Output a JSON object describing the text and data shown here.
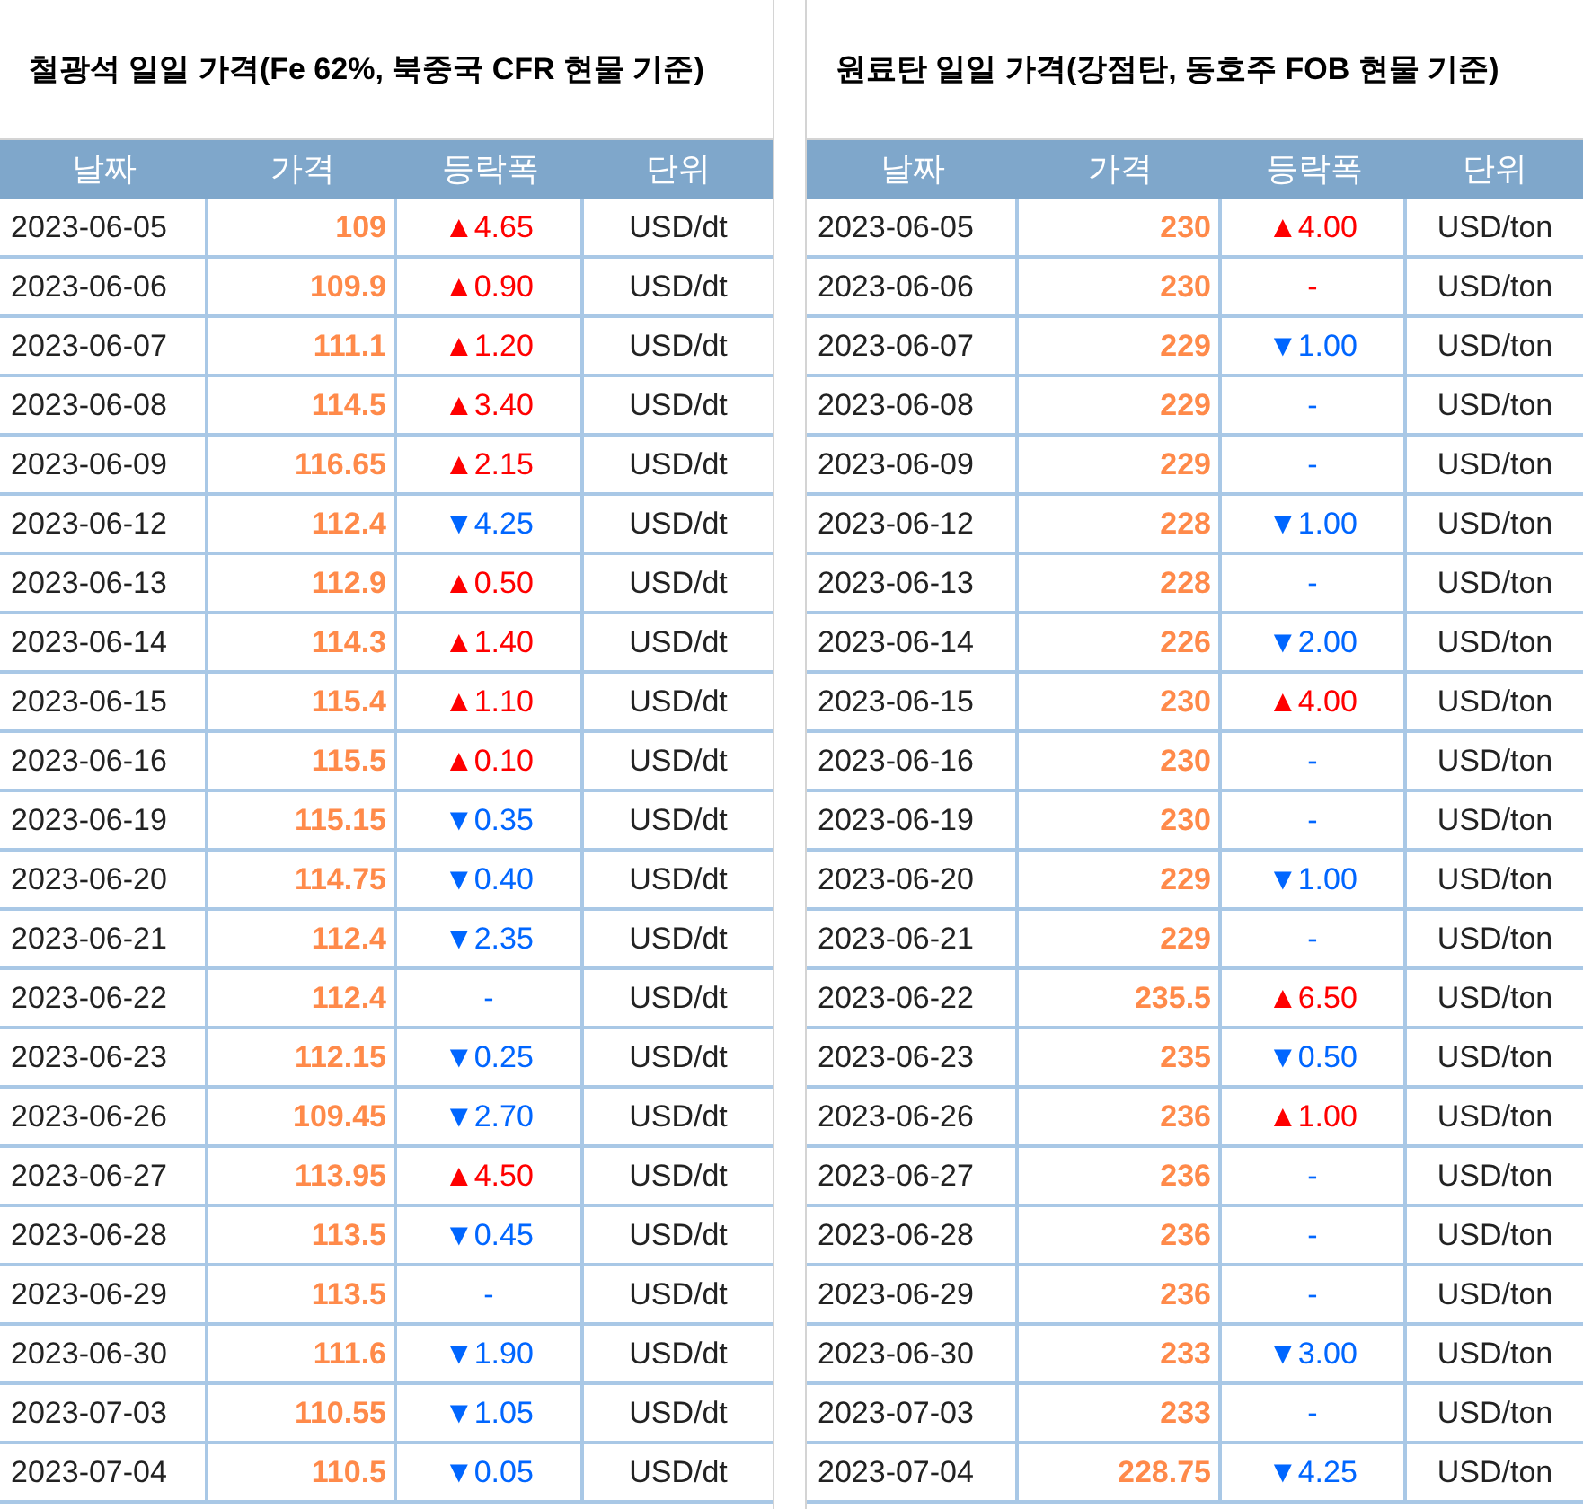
{
  "tables": [
    {
      "title": "철광석 일일 가격(Fe 62%, 북중국 CFR 현물 기준)",
      "columns": [
        "날짜",
        "가격",
        "등락폭",
        "단위"
      ],
      "rows": [
        {
          "date": "2023-06-05",
          "price": "109",
          "change": {
            "text": "▲4.65",
            "color": "#ff0000"
          },
          "unit": "USD/dt"
        },
        {
          "date": "2023-06-06",
          "price": "109.9",
          "change": {
            "text": "▲0.90",
            "color": "#ff0000"
          },
          "unit": "USD/dt"
        },
        {
          "date": "2023-06-07",
          "price": "111.1",
          "change": {
            "text": "▲1.20",
            "color": "#ff0000"
          },
          "unit": "USD/dt"
        },
        {
          "date": "2023-06-08",
          "price": "114.5",
          "change": {
            "text": "▲3.40",
            "color": "#ff0000"
          },
          "unit": "USD/dt"
        },
        {
          "date": "2023-06-09",
          "price": "116.65",
          "change": {
            "text": "▲2.15",
            "color": "#ff0000"
          },
          "unit": "USD/dt"
        },
        {
          "date": "2023-06-12",
          "price": "112.4",
          "change": {
            "text": "▼4.25",
            "color": "#0066ff"
          },
          "unit": "USD/dt"
        },
        {
          "date": "2023-06-13",
          "price": "112.9",
          "change": {
            "text": "▲0.50",
            "color": "#ff0000"
          },
          "unit": "USD/dt"
        },
        {
          "date": "2023-06-14",
          "price": "114.3",
          "change": {
            "text": "▲1.40",
            "color": "#ff0000"
          },
          "unit": "USD/dt"
        },
        {
          "date": "2023-06-15",
          "price": "115.4",
          "change": {
            "text": "▲1.10",
            "color": "#ff0000"
          },
          "unit": "USD/dt"
        },
        {
          "date": "2023-06-16",
          "price": "115.5",
          "change": {
            "text": "▲0.10",
            "color": "#ff0000"
          },
          "unit": "USD/dt"
        },
        {
          "date": "2023-06-19",
          "price": "115.15",
          "change": {
            "text": "▼0.35",
            "color": "#0066ff"
          },
          "unit": "USD/dt"
        },
        {
          "date": "2023-06-20",
          "price": "114.75",
          "change": {
            "text": "▼0.40",
            "color": "#0066ff"
          },
          "unit": "USD/dt"
        },
        {
          "date": "2023-06-21",
          "price": "112.4",
          "change": {
            "text": "▼2.35",
            "color": "#0066ff"
          },
          "unit": "USD/dt"
        },
        {
          "date": "2023-06-22",
          "price": "112.4",
          "change": {
            "text": "-",
            "color": "#0066ff"
          },
          "unit": "USD/dt"
        },
        {
          "date": "2023-06-23",
          "price": "112.15",
          "change": {
            "text": "▼0.25",
            "color": "#0066ff"
          },
          "unit": "USD/dt"
        },
        {
          "date": "2023-06-26",
          "price": "109.45",
          "change": {
            "text": "▼2.70",
            "color": "#0066ff"
          },
          "unit": "USD/dt"
        },
        {
          "date": "2023-06-27",
          "price": "113.95",
          "change": {
            "text": "▲4.50",
            "color": "#ff0000"
          },
          "unit": "USD/dt"
        },
        {
          "date": "2023-06-28",
          "price": "113.5",
          "change": {
            "text": "▼0.45",
            "color": "#0066ff"
          },
          "unit": "USD/dt"
        },
        {
          "date": "2023-06-29",
          "price": "113.5",
          "change": {
            "text": "-",
            "color": "#0066ff"
          },
          "unit": "USD/dt"
        },
        {
          "date": "2023-06-30",
          "price": "111.6",
          "change": {
            "text": "▼1.90",
            "color": "#0066ff"
          },
          "unit": "USD/dt"
        },
        {
          "date": "2023-07-03",
          "price": "110.55",
          "change": {
            "text": "▼1.05",
            "color": "#0066ff"
          },
          "unit": "USD/dt"
        },
        {
          "date": "2023-07-04",
          "price": "110.5",
          "change": {
            "text": "▼0.05",
            "color": "#0066ff"
          },
          "unit": "USD/dt"
        }
      ]
    },
    {
      "title": "원료탄 일일 가격(강점탄, 동호주 FOB 현물 기준)",
      "columns": [
        "날짜",
        "가격",
        "등락폭",
        "단위"
      ],
      "rows": [
        {
          "date": "2023-06-05",
          "price": "230",
          "change": {
            "text": "▲4.00",
            "color": "#ff0000"
          },
          "unit": "USD/ton"
        },
        {
          "date": "2023-06-06",
          "price": "230",
          "change": {
            "text": "-",
            "color": "#ff0000"
          },
          "unit": "USD/ton"
        },
        {
          "date": "2023-06-07",
          "price": "229",
          "change": {
            "text": "▼1.00",
            "color": "#0066ff"
          },
          "unit": "USD/ton"
        },
        {
          "date": "2023-06-08",
          "price": "229",
          "change": {
            "text": "-",
            "color": "#0066ff"
          },
          "unit": "USD/ton"
        },
        {
          "date": "2023-06-09",
          "price": "229",
          "change": {
            "text": "-",
            "color": "#0066ff"
          },
          "unit": "USD/ton"
        },
        {
          "date": "2023-06-12",
          "price": "228",
          "change": {
            "text": "▼1.00",
            "color": "#0066ff"
          },
          "unit": "USD/ton"
        },
        {
          "date": "2023-06-13",
          "price": "228",
          "change": {
            "text": "-",
            "color": "#0066ff"
          },
          "unit": "USD/ton"
        },
        {
          "date": "2023-06-14",
          "price": "226",
          "change": {
            "text": "▼2.00",
            "color": "#0066ff"
          },
          "unit": "USD/ton"
        },
        {
          "date": "2023-06-15",
          "price": "230",
          "change": {
            "text": "▲4.00",
            "color": "#ff0000"
          },
          "unit": "USD/ton"
        },
        {
          "date": "2023-06-16",
          "price": "230",
          "change": {
            "text": "-",
            "color": "#0066ff"
          },
          "unit": "USD/ton"
        },
        {
          "date": "2023-06-19",
          "price": "230",
          "change": {
            "text": "-",
            "color": "#0066ff"
          },
          "unit": "USD/ton"
        },
        {
          "date": "2023-06-20",
          "price": "229",
          "change": {
            "text": "▼1.00",
            "color": "#0066ff"
          },
          "unit": "USD/ton"
        },
        {
          "date": "2023-06-21",
          "price": "229",
          "change": {
            "text": "-",
            "color": "#0066ff"
          },
          "unit": "USD/ton"
        },
        {
          "date": "2023-06-22",
          "price": "235.5",
          "change": {
            "text": "▲6.50",
            "color": "#ff0000"
          },
          "unit": "USD/ton"
        },
        {
          "date": "2023-06-23",
          "price": "235",
          "change": {
            "text": "▼0.50",
            "color": "#0066ff"
          },
          "unit": "USD/ton"
        },
        {
          "date": "2023-06-26",
          "price": "236",
          "change": {
            "text": "▲1.00",
            "color": "#ff0000"
          },
          "unit": "USD/ton"
        },
        {
          "date": "2023-06-27",
          "price": "236",
          "change": {
            "text": "-",
            "color": "#0066ff"
          },
          "unit": "USD/ton"
        },
        {
          "date": "2023-06-28",
          "price": "236",
          "change": {
            "text": "-",
            "color": "#0066ff"
          },
          "unit": "USD/ton"
        },
        {
          "date": "2023-06-29",
          "price": "236",
          "change": {
            "text": "-",
            "color": "#0066ff"
          },
          "unit": "USD/ton"
        },
        {
          "date": "2023-06-30",
          "price": "233",
          "change": {
            "text": "▼3.00",
            "color": "#0066ff"
          },
          "unit": "USD/ton"
        },
        {
          "date": "2023-07-03",
          "price": "233",
          "change": {
            "text": "-",
            "color": "#0066ff"
          },
          "unit": "USD/ton"
        },
        {
          "date": "2023-07-04",
          "price": "228.75",
          "change": {
            "text": "▼4.25",
            "color": "#0066ff"
          },
          "unit": "USD/ton"
        }
      ]
    }
  ]
}
